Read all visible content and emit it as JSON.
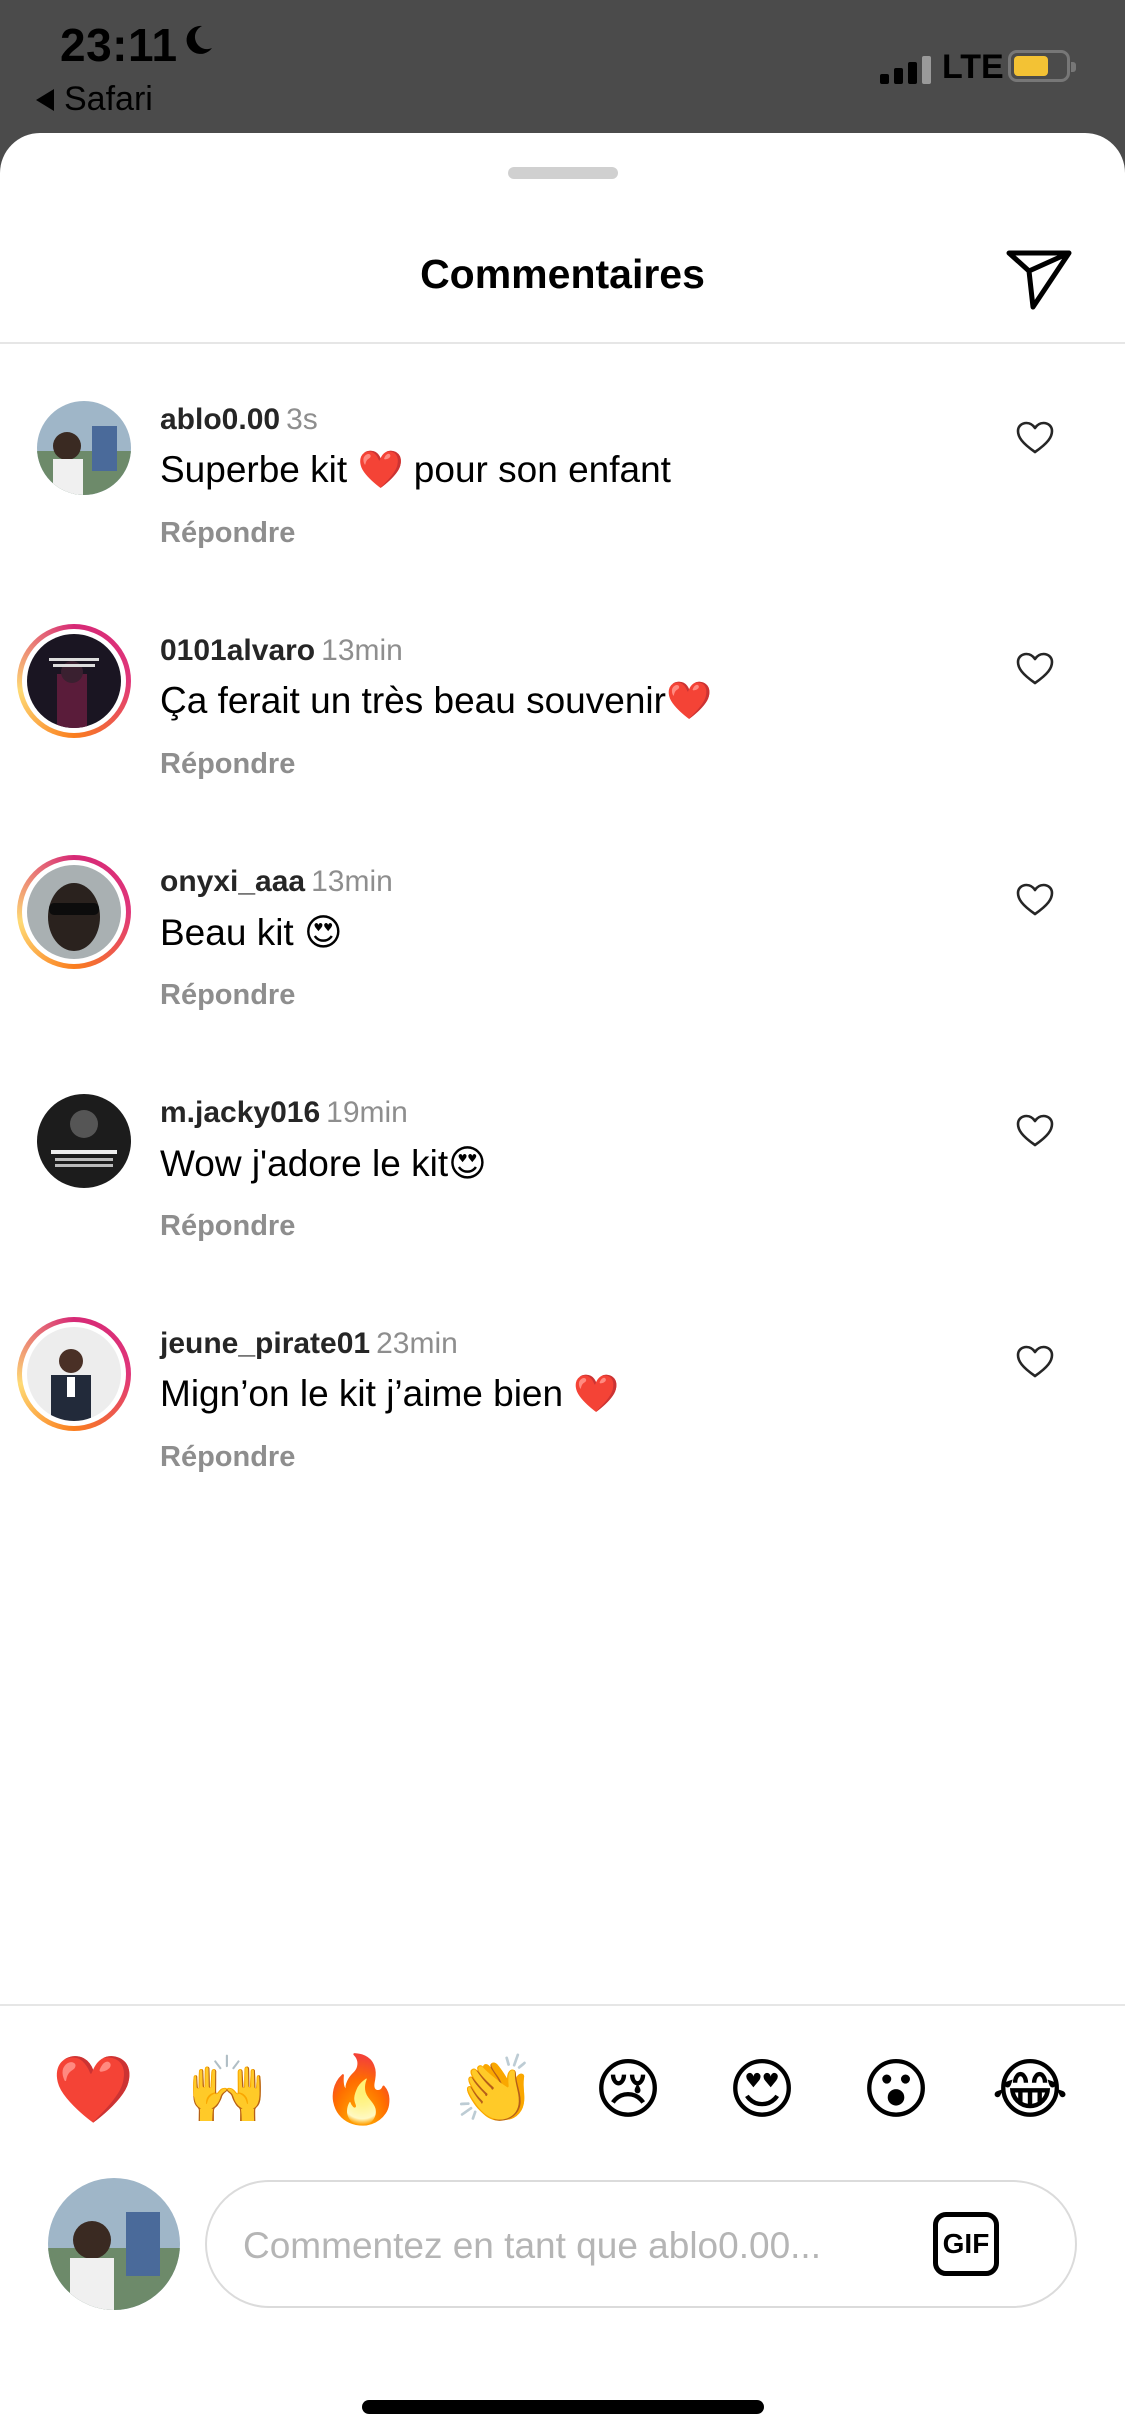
{
  "status_bar": {
    "time": "23:11",
    "back_app": "Safari",
    "network": "LTE",
    "icons": [
      "moon-icon",
      "signal-icon",
      "battery-icon"
    ]
  },
  "header": {
    "title": "Commentaires",
    "send_icon": "paper-plane-icon"
  },
  "comments": [
    {
      "user": "ablo0.00",
      "time": "3s",
      "text": "Superbe kit ❤️ pour son enfant",
      "reply": "Répondre",
      "story_ring": false
    },
    {
      "user": "0101alvaro",
      "time": "13min",
      "text": "Ça ferait un très beau souvenir❤️",
      "reply": "Répondre",
      "story_ring": true
    },
    {
      "user": "onyxi_aaa",
      "time": "13min",
      "text": "Beau kit 😍",
      "reply": "Répondre",
      "story_ring": true
    },
    {
      "user": "m.jacky016",
      "time": "19min",
      "text": "Wow j'adore le kit😍",
      "reply": "Répondre",
      "story_ring": false
    },
    {
      "user": "jeune_pirate01",
      "time": "23min",
      "text": "Mign’on le kit j’aime bien ❤️",
      "reply": "Répondre",
      "story_ring": true
    }
  ],
  "quick_emojis": [
    "❤️",
    "🙌",
    "🔥",
    "👏",
    "😢",
    "😍",
    "😮",
    "😂"
  ],
  "composer": {
    "placeholder": "Commentez en tant que ablo0.00...",
    "gif_label": "GIF"
  },
  "colors": {
    "story_ring": [
      "#d62976",
      "#fa7e1e",
      "#feda75"
    ],
    "battery": "#f3c234",
    "secondary_text": "#8e8e8e"
  }
}
